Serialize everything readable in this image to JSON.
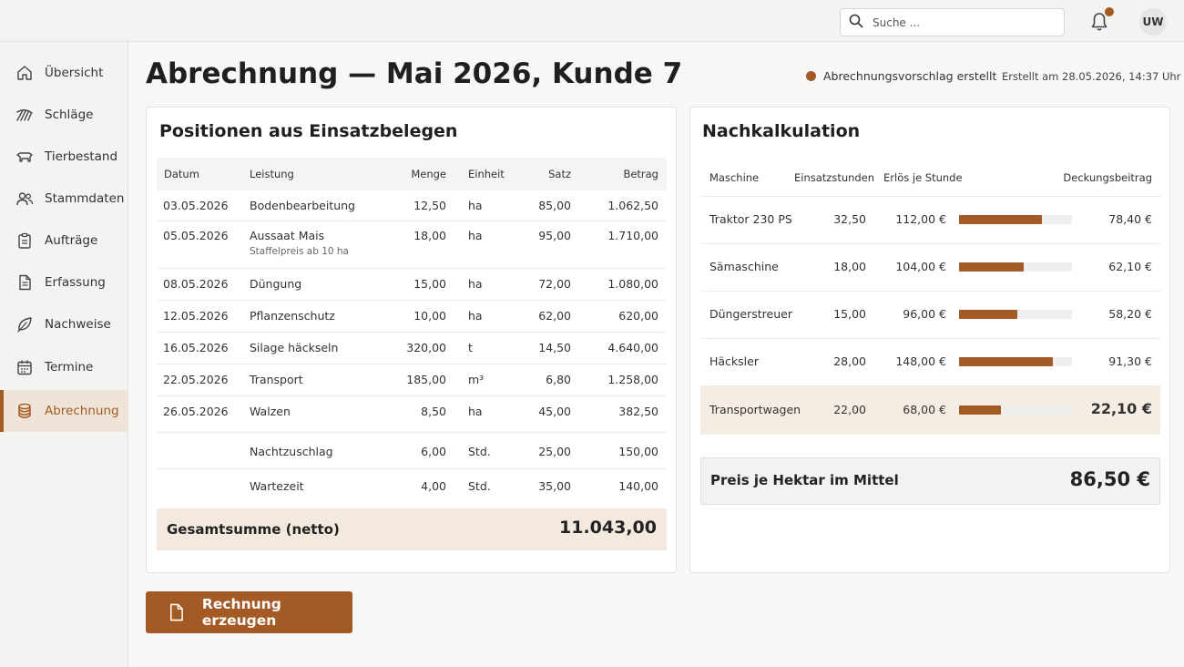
{
  "header": {
    "search_placeholder": "Suche ...",
    "avatar_initials": "UW",
    "notification_indicator_color": "#a45a24"
  },
  "sidebar": {
    "items": [
      {
        "label": "Übersicht",
        "icon": "home-icon"
      },
      {
        "label": "Schläge",
        "icon": "fields-icon"
      },
      {
        "label": "Tierbestand",
        "icon": "cow-icon"
      },
      {
        "label": "Stammdaten",
        "icon": "users-icon"
      },
      {
        "label": "Aufträge",
        "icon": "clipboard-icon"
      },
      {
        "label": "Erfassung",
        "icon": "document-icon"
      },
      {
        "label": "Nachweise",
        "icon": "leaf-icon"
      },
      {
        "label": "Termine",
        "icon": "calendar-icon"
      },
      {
        "label": "Abrechnung",
        "icon": "coins-icon",
        "active": true
      }
    ]
  },
  "page": {
    "title": "Abrechnung — Mai 2026, Kunde 7",
    "status": "Abrechnungsvorschlag erstellt",
    "status_color": "#a45a24",
    "created": "Erstellt am 28.05.2026, 14:37 Uhr"
  },
  "positions": {
    "title": "Positionen aus Einsatzbelegen",
    "columns": [
      "Datum",
      "Leistung",
      "Menge",
      "Einheit",
      "Satz",
      "Betrag"
    ],
    "rows": [
      {
        "datum": "03.05.2026",
        "leistung": "Bodenbearbeitung",
        "sub": "",
        "menge": "12,50",
        "einheit": "ha",
        "satz": "85,00",
        "betrag": "1.062,50"
      },
      {
        "datum": "05.05.2026",
        "leistung": "Aussaat Mais",
        "sub": "Staffelpreis ab 10 ha",
        "menge": "18,00",
        "einheit": "ha",
        "satz": "95,00",
        "betrag": "1.710,00"
      },
      {
        "datum": "08.05.2026",
        "leistung": "Düngung",
        "sub": "",
        "menge": "15,00",
        "einheit": "ha",
        "satz": "72,00",
        "betrag": "1.080,00"
      },
      {
        "datum": "12.05.2026",
        "leistung": "Pflanzenschutz",
        "sub": "",
        "menge": "10,00",
        "einheit": "ha",
        "satz": "62,00",
        "betrag": "620,00"
      },
      {
        "datum": "16.05.2026",
        "leistung": "Silage häckseln",
        "sub": "",
        "menge": "320,00",
        "einheit": "t",
        "satz": "14,50",
        "betrag": "4.640,00"
      },
      {
        "datum": "22.05.2026",
        "leistung": "Transport",
        "sub": "",
        "menge": "185,00",
        "einheit": "m³",
        "satz": "6,80",
        "betrag": "1.258,00"
      },
      {
        "datum": "26.05.2026",
        "leistung": "Walzen",
        "sub": "",
        "menge": "8,50",
        "einheit": "ha",
        "satz": "45,00",
        "betrag": "382,50"
      },
      {
        "datum": "",
        "leistung": "Nachtzuschlag",
        "sub": "",
        "menge": "6,00",
        "einheit": "Std.",
        "satz": "25,00",
        "betrag": "150,00"
      },
      {
        "datum": "",
        "leistung": "Wartezeit",
        "sub": "",
        "menge": "4,00",
        "einheit": "Std.",
        "satz": "35,00",
        "betrag": "140,00"
      }
    ],
    "total_label": "Gesamtsumme (netto)",
    "total_value": "11.043,00"
  },
  "nachkalkulation": {
    "title": "Nachkalkulation",
    "columns": [
      "Maschine",
      "Einsatzstunden",
      "Erlös je Stunde",
      "Deckungsbeitrag"
    ],
    "rows": [
      {
        "maschine": "Traktor 230 PS",
        "stunden": "32,50",
        "erloes": "112,00 €",
        "level": 0.73,
        "db": "78,40 €"
      },
      {
        "maschine": "Sämaschine",
        "stunden": "18,00",
        "erloes": "104,00 €",
        "level": 0.57,
        "db": "62,10 €"
      },
      {
        "maschine": "Düngerstreuer",
        "stunden": "15,00",
        "erloes": "96,00 €",
        "level": 0.52,
        "db": "58,20 €"
      },
      {
        "maschine": "Häcksler",
        "stunden": "28,00",
        "erloes": "148,00 €",
        "level": 0.83,
        "db": "91,30 €"
      },
      {
        "maschine": "Transportwagen",
        "stunden": "22,00",
        "erloes": "68,00 €",
        "level": 0.37,
        "db": "22,10 €",
        "highlight": true
      }
    ],
    "price_label": "Preis je Hektar im Mittel",
    "price_value": "86,50 €"
  },
  "actions": {
    "create_invoice": "Rechnung erzeugen"
  }
}
